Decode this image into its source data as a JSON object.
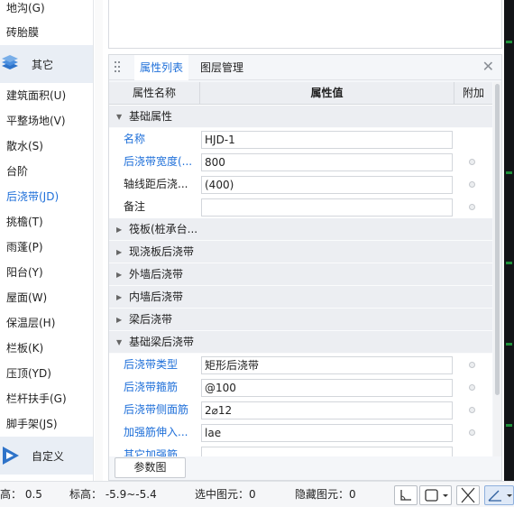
{
  "sidebar": {
    "items_top": [
      {
        "label": "地沟(G)"
      },
      {
        "label": "砖胎膜"
      }
    ],
    "category_other": {
      "label": "其它",
      "icon": "layers-icon"
    },
    "items": [
      {
        "label": "建筑面积(U)"
      },
      {
        "label": "平整场地(V)"
      },
      {
        "label": "散水(S)"
      },
      {
        "label": "台阶"
      },
      {
        "label": "后浇带(JD)",
        "active": true
      },
      {
        "label": "挑檐(T)"
      },
      {
        "label": "雨蓬(P)"
      },
      {
        "label": "阳台(Y)"
      },
      {
        "label": "屋面(W)"
      },
      {
        "label": "保温层(H)"
      },
      {
        "label": "栏板(K)"
      },
      {
        "label": "压顶(YD)"
      },
      {
        "label": "栏杆扶手(G)"
      },
      {
        "label": "脚手架(JS)"
      }
    ],
    "category_custom": {
      "label": "自定义",
      "icon": "play-icon"
    }
  },
  "panel": {
    "tabs": [
      "属性列表",
      "图层管理"
    ],
    "close_icon": "close-icon",
    "headers": {
      "name": "属性名称",
      "value": "属性值",
      "extra": "附加"
    },
    "rows": [
      {
        "type": "group",
        "label": "基础属性",
        "expanded": true
      },
      {
        "type": "prop",
        "name": "名称",
        "value": "HJD-1",
        "blue": true,
        "dot": false
      },
      {
        "type": "prop",
        "name": "后浇带宽度(...",
        "value": "800",
        "blue": true,
        "dot": true
      },
      {
        "type": "prop",
        "name": "轴线距后浇...",
        "value": "(400)",
        "blue": false,
        "dot": true
      },
      {
        "type": "prop",
        "name": "备注",
        "value": "",
        "blue": false,
        "dot": true
      },
      {
        "type": "group",
        "label": "筏板(桩承台...",
        "expanded": false
      },
      {
        "type": "group",
        "label": "现浇板后浇带",
        "expanded": false
      },
      {
        "type": "group",
        "label": "外墙后浇带",
        "expanded": false
      },
      {
        "type": "group",
        "label": "内墙后浇带",
        "expanded": false
      },
      {
        "type": "group",
        "label": "梁后浇带",
        "expanded": false
      },
      {
        "type": "group",
        "label": "基础梁后浇带",
        "expanded": true
      },
      {
        "type": "prop",
        "name": "后浇带类型",
        "value": "矩形后浇带",
        "blue": true,
        "dot": true
      },
      {
        "type": "prop",
        "name": "后浇带箍筋",
        "value": "@100",
        "blue": true,
        "dot": true
      },
      {
        "type": "prop",
        "name": "后浇带侧面筋",
        "value": "2⌀12",
        "blue": true,
        "dot": true
      },
      {
        "type": "prop",
        "name": "加强筋伸入...",
        "value": "lae",
        "blue": true,
        "dot": true
      },
      {
        "type": "prop",
        "name": "其它加强筋",
        "value": "",
        "blue": true,
        "dot": false
      }
    ],
    "param_button": "参数图"
  },
  "status": {
    "height_label": "高： 0.5",
    "elevation_label": "标高： -5.9~-5.4",
    "selected_label": "选中图元：0",
    "hidden_label": "隐藏图元：0",
    "tools": [
      "axis-corner-icon",
      "rect-select-icon",
      "cross-icon",
      "angle-icon"
    ]
  },
  "colors": {
    "accent": "#1e6fd9",
    "group_bg": "#eceef2",
    "strip": "#121417",
    "strip_mark": "#1f8f3a"
  }
}
